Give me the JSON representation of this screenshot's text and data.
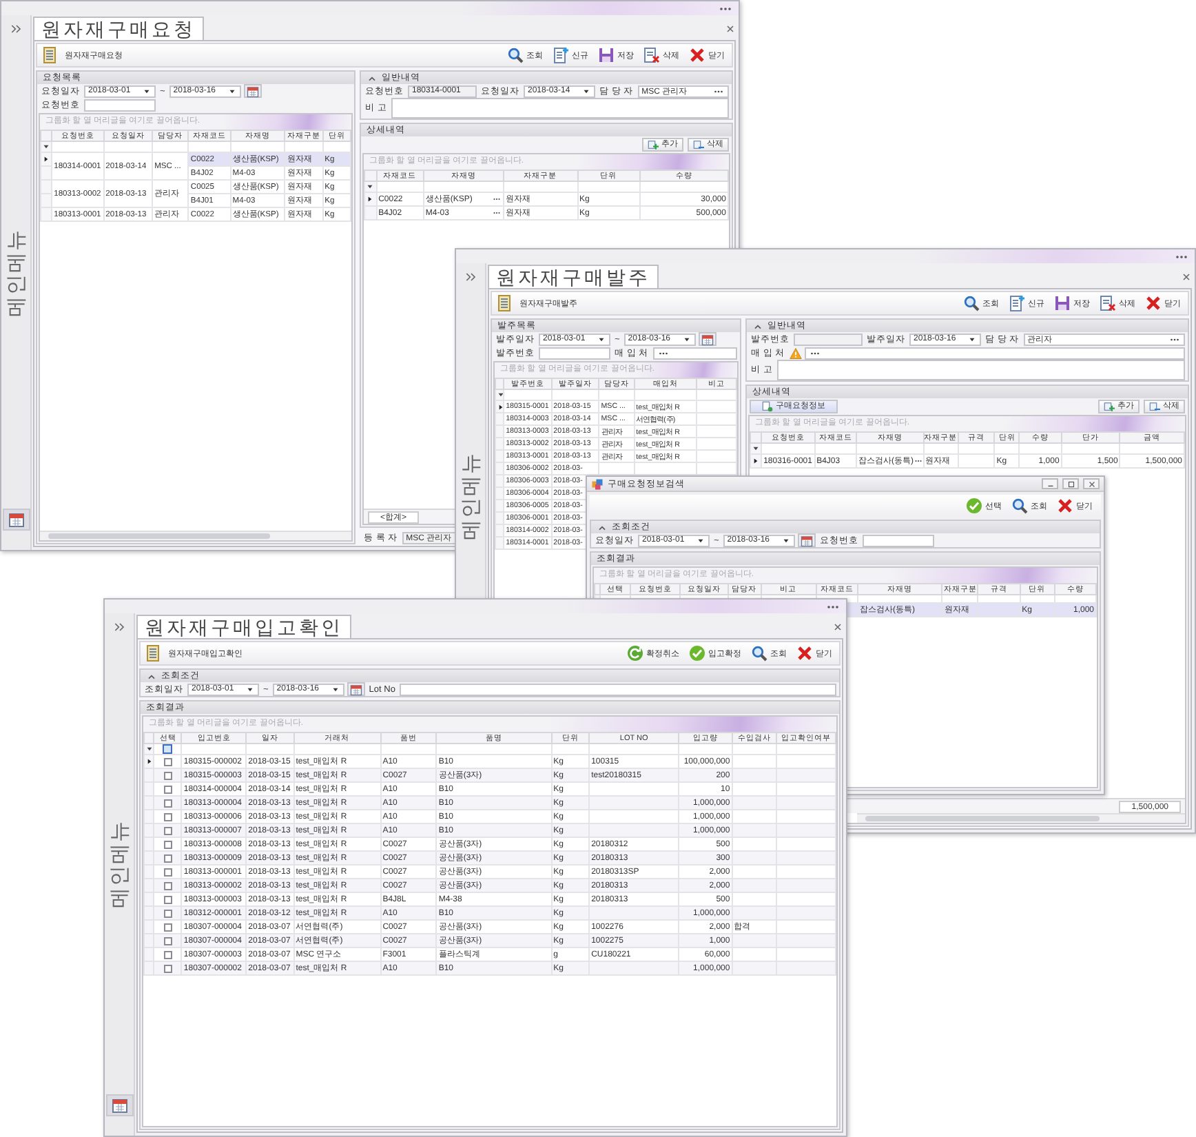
{
  "windows": [
    {
      "kind": "request",
      "title": "원자재구매요청",
      "side_label": "메인메뉴",
      "subtitle": "원자재구매요청",
      "toolbar": [
        {
          "kind": "search",
          "label": "조회"
        },
        {
          "kind": "new",
          "label": "신규"
        },
        {
          "kind": "save",
          "label": "저장"
        },
        {
          "kind": "delete",
          "label": "삭제"
        },
        {
          "kind": "close",
          "label": "닫기"
        }
      ],
      "list_panel": {
        "title": "요청목록",
        "filters": [
          [
            {
              "kind": "label",
              "text": "요청일자"
            },
            {
              "kind": "date",
              "value": "2018-03-01"
            },
            {
              "kind": "label",
              "text": "~"
            },
            {
              "kind": "date",
              "value": "2018-03-16"
            },
            {
              "kind": "calendar"
            }
          ],
          [
            {
              "kind": "label",
              "text": "요청번호"
            },
            {
              "kind": "text"
            }
          ]
        ],
        "grid": {
          "hint": "그룹화 할 열 머리글을 여기로 끌어옵니다.",
          "columns": [
            "요청번호",
            "요청일자",
            "담당자",
            "자재코드",
            "자재명",
            "자재구분",
            "단위"
          ],
          "rows": [
            {
              "request_no": "180314-0001",
              "request_date": "2018-03-14",
              "requester": "MSC ...",
              "items": [
                {
                  "material_code": "C0022",
                  "material_name": "생산품(KSP)",
                  "material_type": "원자재",
                  "unit": "Kg",
                  "selected": true
                },
                {
                  "material_code": "B4J02",
                  "material_name": "M4-03",
                  "material_type": "원자재",
                  "unit": "Kg",
                  "selected": false
                }
              ]
            },
            {
              "request_no": "180313-0002",
              "request_date": "2018-03-13",
              "requester": "관리자",
              "items": [
                {
                  "material_code": "C0025",
                  "material_name": "생산품(KSP)",
                  "material_type": "원자재",
                  "unit": "Kg",
                  "selected": false
                },
                {
                  "material_code": "B4J01",
                  "material_name": "M4-03",
                  "material_type": "원자재",
                  "unit": "Kg",
                  "selected": false
                }
              ]
            },
            {
              "request_no": "180313-0001",
              "request_date": "2018-03-13",
              "requester": "관리자",
              "items": [
                {
                  "material_code": "C0022",
                  "material_name": "생산품(KSP)",
                  "material_type": "원자재",
                  "unit": "Kg",
                  "selected": false
                }
              ]
            }
          ]
        }
      },
      "general_panel": {
        "title": "일반내역",
        "expanded": true,
        "fields": [
          [
            {
              "kind": "label",
              "text": "요청번호"
            },
            {
              "kind": "readonly",
              "value": "180314-0001"
            },
            {
              "kind": "label",
              "text": "요청일자"
            },
            {
              "kind": "date",
              "value": "2018-03-14"
            },
            {
              "kind": "label",
              "text": "담 당 자"
            },
            {
              "kind": "lookup",
              "value": "MSC 관리자"
            }
          ],
          [
            {
              "kind": "label",
              "text": "비 고"
            },
            {
              "kind": "memo"
            }
          ]
        ]
      },
      "detail_panel": {
        "title": "상세내역",
        "buttons": [
          {
            "kind": "add",
            "label": "추가"
          },
          {
            "kind": "remove",
            "label": "삭제"
          }
        ],
        "grid": {
          "hint": "그룹화 할 열 머리글을 여기로 끌어옵니다.",
          "columns": [
            "자재코드",
            "자재명",
            "자재구분",
            "단위",
            "수량"
          ],
          "rows": [
            {
              "material_code": "C0022",
              "material_name": "생산품(KSP)",
              "material_type": "원자재",
              "unit": "Kg",
              "quantity": "30,000",
              "selected": true
            },
            {
              "material_code": "B4J02",
              "material_name": "M4-03",
              "material_type": "원자재",
              "unit": "Kg",
              "quantity": "500,000",
              "selected": false
            }
          ],
          "summary": "<합계>"
        }
      },
      "registrant": {
        "label": "등 록 자",
        "value": "MSC 관리자"
      }
    },
    {
      "kind": "order",
      "title": "원자재구매발주",
      "side_label": "메인메뉴",
      "subtitle": "원자재구매발주",
      "toolbar": [
        {
          "kind": "search",
          "label": "조회"
        },
        {
          "kind": "new",
          "label": "신규"
        },
        {
          "kind": "save",
          "label": "저장"
        },
        {
          "kind": "delete",
          "label": "삭제"
        },
        {
          "kind": "close",
          "label": "닫기"
        }
      ],
      "list_panel": {
        "title": "발주목록",
        "filters": [
          [
            {
              "kind": "label",
              "text": "발주일자"
            },
            {
              "kind": "date",
              "value": "2018-03-01"
            },
            {
              "kind": "label",
              "text": "~"
            },
            {
              "kind": "date",
              "value": "2018-03-16"
            },
            {
              "kind": "calendar"
            }
          ],
          [
            {
              "kind": "label",
              "text": "발주번호"
            },
            {
              "kind": "text"
            },
            {
              "kind": "label",
              "text": "매 입 처"
            },
            {
              "kind": "lookup"
            }
          ]
        ],
        "grid": {
          "hint": "그룹화 할 열 머리글을 여기로 끌어옵니다.",
          "columns": [
            "발주번호",
            "발주일자",
            "담당자",
            "매입처",
            "비고"
          ],
          "rows": [
            {
              "order_no": "180315-0001",
              "order_date": "2018-03-15",
              "manager": "MSC ...",
              "vendor": "test_매입처 R",
              "selected": true
            },
            {
              "order_no": "180314-0003",
              "order_date": "2018-03-14",
              "manager": "MSC ...",
              "vendor": "서연협력(주)",
              "selected": false
            },
            {
              "order_no": "180313-0003",
              "order_date": "2018-03-13",
              "manager": "관리자",
              "vendor": "test_매입처 R",
              "selected": false
            },
            {
              "order_no": "180313-0002",
              "order_date": "2018-03-13",
              "manager": "관리자",
              "vendor": "test_매입처 R",
              "selected": false
            },
            {
              "order_no": "180313-0001",
              "order_date": "2018-03-13",
              "manager": "관리자",
              "vendor": "test_매입처 R",
              "selected": false
            },
            {
              "order_no": "180306-0002",
              "order_date": "2018-03-",
              "selected": false
            },
            {
              "order_no": "180306-0003",
              "order_date": "2018-03-",
              "selected": false
            },
            {
              "order_no": "180306-0004",
              "order_date": "2018-03-",
              "selected": false
            },
            {
              "order_no": "180306-0005",
              "order_date": "2018-03-",
              "selected": false
            },
            {
              "order_no": "180306-0001",
              "order_date": "2018-03-",
              "selected": false
            },
            {
              "order_no": "180314-0002",
              "order_date": "2018-03-",
              "selected": false
            },
            {
              "order_no": "180314-0001",
              "order_date": "2018-03-",
              "selected": false
            }
          ]
        }
      },
      "general_panel": {
        "title": "일반내역",
        "expanded": true,
        "fields": [
          [
            {
              "kind": "label",
              "text": "발주번호"
            },
            {
              "kind": "readonly"
            },
            {
              "kind": "label",
              "text": "발주일자"
            },
            {
              "kind": "date",
              "value": "2018-03-16"
            },
            {
              "kind": "label",
              "text": "담 당 자"
            },
            {
              "kind": "lookup",
              "value": "관리자"
            }
          ],
          [
            {
              "kind": "label",
              "text": "매 입 처"
            },
            {
              "kind": "warning"
            },
            {
              "kind": "lookup"
            }
          ],
          [
            {
              "kind": "label",
              "text": "비 고"
            },
            {
              "kind": "memo"
            }
          ]
        ]
      },
      "detail_panel": {
        "title": "상세내역",
        "lead_button": {
          "label": "구매요청정보"
        },
        "buttons": [
          {
            "kind": "add",
            "label": "추가"
          },
          {
            "kind": "remove",
            "label": "삭제"
          }
        ],
        "grid": {
          "hint": "그룹화 할 열 머리글을 여기로 끌어옵니다.",
          "columns": [
            "요청번호",
            "자재코드",
            "자재명",
            "자재구분",
            "규격",
            "단위",
            "수량",
            "단가",
            "금액"
          ],
          "rows": [
            {
              "request_no": "180316-0001",
              "material_code": "B4J03",
              "material_name": "잡스검사(동특)",
              "material_type": "원자재",
              "unit": "Kg",
              "quantity": "1,000",
              "unit_price": "1,500",
              "amount": "1,500,000",
              "selected": true
            }
          ],
          "total": "1,500,000"
        }
      }
    },
    {
      "kind": "search-dialog",
      "title": "구매요청정보검색",
      "toolbar": [
        {
          "kind": "select",
          "label": "선택"
        },
        {
          "kind": "search",
          "label": "조회"
        },
        {
          "kind": "close",
          "label": "닫기"
        }
      ],
      "condition_panel": {
        "title": "조회조건",
        "expanded": true,
        "filters": [
          [
            {
              "kind": "label",
              "text": "요청일자"
            },
            {
              "kind": "date",
              "value": "2018-03-01"
            },
            {
              "kind": "label",
              "text": "~"
            },
            {
              "kind": "date",
              "value": "2018-03-16"
            },
            {
              "kind": "calendar"
            },
            {
              "kind": "label",
              "text": "요청번호"
            },
            {
              "kind": "text"
            }
          ]
        ]
      },
      "result_panel": {
        "title": "조회결과",
        "grid": {
          "hint": "그룹화 할 열 머리글을 여기로 끌어옵니다.",
          "columns": [
            "선택",
            "요청번호",
            "요청일자",
            "담당자",
            "비고",
            "자재코드",
            "자재명",
            "자재구분",
            "규격",
            "단위",
            "수량"
          ],
          "rows": [
            {
              "material_name": "잡스검사(동특)",
              "material_type": "원자재",
              "unit": "Kg",
              "quantity": "1,000",
              "selected": true
            }
          ]
        }
      }
    },
    {
      "kind": "receipt",
      "title": "원자재구매입고확인",
      "side_label": "메인메뉴",
      "subtitle": "원자재구매입고확인",
      "toolbar": [
        {
          "kind": "cancel",
          "label": "확정취소"
        },
        {
          "kind": "confirm",
          "label": "입고확정"
        },
        {
          "kind": "search",
          "label": "조회"
        },
        {
          "kind": "close",
          "label": "닫기"
        }
      ],
      "condition_panel": {
        "title": "조회조건",
        "expanded": true,
        "filters": [
          [
            {
              "kind": "label",
              "text": "조회일자"
            },
            {
              "kind": "date",
              "value": "2018-03-01"
            },
            {
              "kind": "label",
              "text": "~"
            },
            {
              "kind": "date",
              "value": "2018-03-16"
            },
            {
              "kind": "calendar"
            },
            {
              "kind": "label",
              "text": "Lot No"
            },
            {
              "kind": "fill"
            }
          ]
        ]
      },
      "result_panel": {
        "title": "조회결과",
        "grid": {
          "hint": "그룹화 할 열 머리글을 여기로 끌어옵니다.",
          "select_all": {
            "checked": false
          },
          "columns": [
            "선택",
            "입고번호",
            "일자",
            "거래처",
            "품번",
            "품명",
            "단위",
            "LOT NO",
            "입고량",
            "수입검사",
            "입고확인여부"
          ],
          "rows": [
            {
              "checked": false,
              "receipt_no": "180315-000002",
              "date": "2018-03-15",
              "vendor": "test_매입처 R",
              "item_code": "A10",
              "item_name": "B10",
              "unit": "Kg",
              "lot_no": "100315",
              "quantity": "100,000,000",
              "selected": true
            },
            {
              "checked": false,
              "receipt_no": "180315-000003",
              "date": "2018-03-15",
              "vendor": "test_매입처 R",
              "item_code": "C0027",
              "item_name": "공산품(3자)",
              "unit": "Kg",
              "lot_no": "test20180315",
              "quantity": "200",
              "selected": false
            },
            {
              "checked": false,
              "receipt_no": "180314-000004",
              "date": "2018-03-14",
              "vendor": "test_매입처 R",
              "item_code": "A10",
              "item_name": "B10",
              "unit": "Kg",
              "quantity": "10",
              "selected": false
            },
            {
              "checked": false,
              "receipt_no": "180313-000004",
              "date": "2018-03-13",
              "vendor": "test_매입처 R",
              "item_code": "A10",
              "item_name": "B10",
              "unit": "Kg",
              "quantity": "1,000,000",
              "selected": false
            },
            {
              "checked": false,
              "receipt_no": "180313-000006",
              "date": "2018-03-13",
              "vendor": "test_매입처 R",
              "item_code": "A10",
              "item_name": "B10",
              "unit": "Kg",
              "quantity": "1,000,000",
              "selected": false
            },
            {
              "checked": false,
              "receipt_no": "180313-000007",
              "date": "2018-03-13",
              "vendor": "test_매입처 R",
              "item_code": "A10",
              "item_name": "B10",
              "unit": "Kg",
              "quantity": "1,000,000",
              "selected": false
            },
            {
              "checked": false,
              "receipt_no": "180313-000008",
              "date": "2018-03-13",
              "vendor": "test_매입처 R",
              "item_code": "C0027",
              "item_name": "공산품(3자)",
              "unit": "Kg",
              "lot_no": "20180312",
              "quantity": "500",
              "selected": false
            },
            {
              "checked": false,
              "receipt_no": "180313-000009",
              "date": "2018-03-13",
              "vendor": "test_매입처 R",
              "item_code": "C0027",
              "item_name": "공산품(3자)",
              "unit": "Kg",
              "lot_no": "20180313",
              "quantity": "300",
              "selected": false
            },
            {
              "checked": false,
              "receipt_no": "180313-000001",
              "date": "2018-03-13",
              "vendor": "test_매입처 R",
              "item_code": "C0027",
              "item_name": "공산품(3자)",
              "unit": "Kg",
              "lot_no": "20180313SP",
              "quantity": "2,000",
              "selected": false
            },
            {
              "checked": false,
              "receipt_no": "180313-000002",
              "date": "2018-03-13",
              "vendor": "test_매입처 R",
              "item_code": "C0027",
              "item_name": "공산품(3자)",
              "unit": "Kg",
              "lot_no": "20180313",
              "quantity": "2,000",
              "selected": false
            },
            {
              "checked": false,
              "receipt_no": "180313-000003",
              "date": "2018-03-13",
              "vendor": "test_매입처 R",
              "item_code": "B4J8L",
              "item_name": "M4-38",
              "unit": "Kg",
              "lot_no": "20180313",
              "quantity": "500",
              "selected": false
            },
            {
              "checked": false,
              "receipt_no": "180312-000001",
              "date": "2018-03-12",
              "vendor": "test_매입처 R",
              "item_code": "A10",
              "item_name": "B10",
              "unit": "Kg",
              "quantity": "1,000,000",
              "selected": false
            },
            {
              "checked": false,
              "receipt_no": "180307-000004",
              "date": "2018-03-07",
              "vendor": "서연협력(주)",
              "item_code": "C0027",
              "item_name": "공산품(3자)",
              "unit": "Kg",
              "lot_no": "1002276",
              "quantity": "2,000",
              "inspection": "합격",
              "selected": false
            },
            {
              "checked": false,
              "receipt_no": "180307-000004",
              "date": "2018-03-07",
              "vendor": "서연협력(주)",
              "item_code": "C0027",
              "item_name": "공산품(3자)",
              "unit": "Kg",
              "lot_no": "1002275",
              "quantity": "1,000",
              "selected": false
            },
            {
              "checked": false,
              "receipt_no": "180307-000003",
              "date": "2018-03-07",
              "vendor": "MSC 연구소",
              "item_code": "F3001",
              "item_name": "플라스틱계",
              "unit": "g",
              "lot_no": "CU180221",
              "quantity": "60,000",
              "selected": false
            },
            {
              "checked": false,
              "receipt_no": "180307-000002",
              "date": "2018-03-07",
              "vendor": "test_매입처 R",
              "item_code": "A10",
              "item_name": "B10",
              "unit": "Kg",
              "quantity": "1,000,000",
              "selected": false
            }
          ]
        }
      }
    }
  ]
}
